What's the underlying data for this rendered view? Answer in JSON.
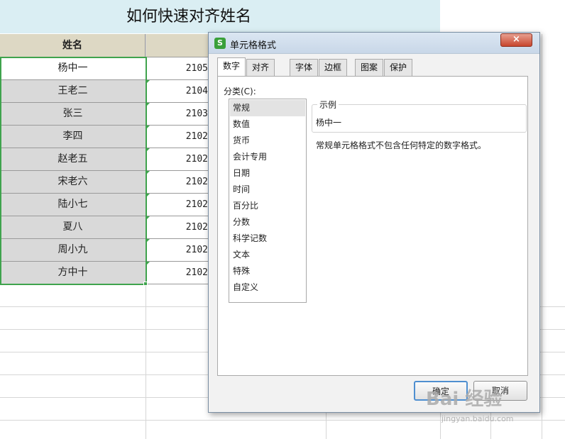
{
  "sheet": {
    "title": "如何快速对齐姓名",
    "header_name": "姓名",
    "rows": [
      {
        "name": "杨中一",
        "id": "2105"
      },
      {
        "name": "王老二",
        "id": "2104"
      },
      {
        "name": "张三",
        "id": "2103"
      },
      {
        "name": "李四",
        "id": "2102"
      },
      {
        "name": "赵老五",
        "id": "2102"
      },
      {
        "name": "宋老六",
        "id": "2102"
      },
      {
        "name": "陆小七",
        "id": "2102"
      },
      {
        "name": "夏八",
        "id": "2102"
      },
      {
        "name": "周小九",
        "id": "2102"
      },
      {
        "name": "方中十",
        "id": "2102"
      }
    ],
    "colors": {
      "title_band": "#daeef3",
      "header": "#ddd8c4",
      "selection": "#3fa34d"
    }
  },
  "dialog": {
    "icon_glyph": "S",
    "title": "单元格格式",
    "close_label": "×",
    "tabs": [
      {
        "label": "数字",
        "active": true
      },
      {
        "label": "对齐",
        "active": false
      },
      {
        "label": "字体",
        "active": false
      },
      {
        "label": "边框",
        "active": false
      },
      {
        "label": "图案",
        "active": false
      },
      {
        "label": "保护",
        "active": false
      }
    ],
    "category_label": "分类(C):",
    "categories": [
      "常规",
      "数值",
      "货币",
      "会计专用",
      "日期",
      "时间",
      "百分比",
      "分数",
      "科学记数",
      "文本",
      "特殊",
      "自定义"
    ],
    "selected_category": "常规",
    "sample_label": "示例",
    "sample_value": "杨中一",
    "description": "常规单元格格式不包含任何特定的数字格式。",
    "ok_label": "确定",
    "cancel_label": "取消"
  },
  "watermark": {
    "text": "Bai 经验",
    "sub": "jingyan.baidu.com"
  }
}
